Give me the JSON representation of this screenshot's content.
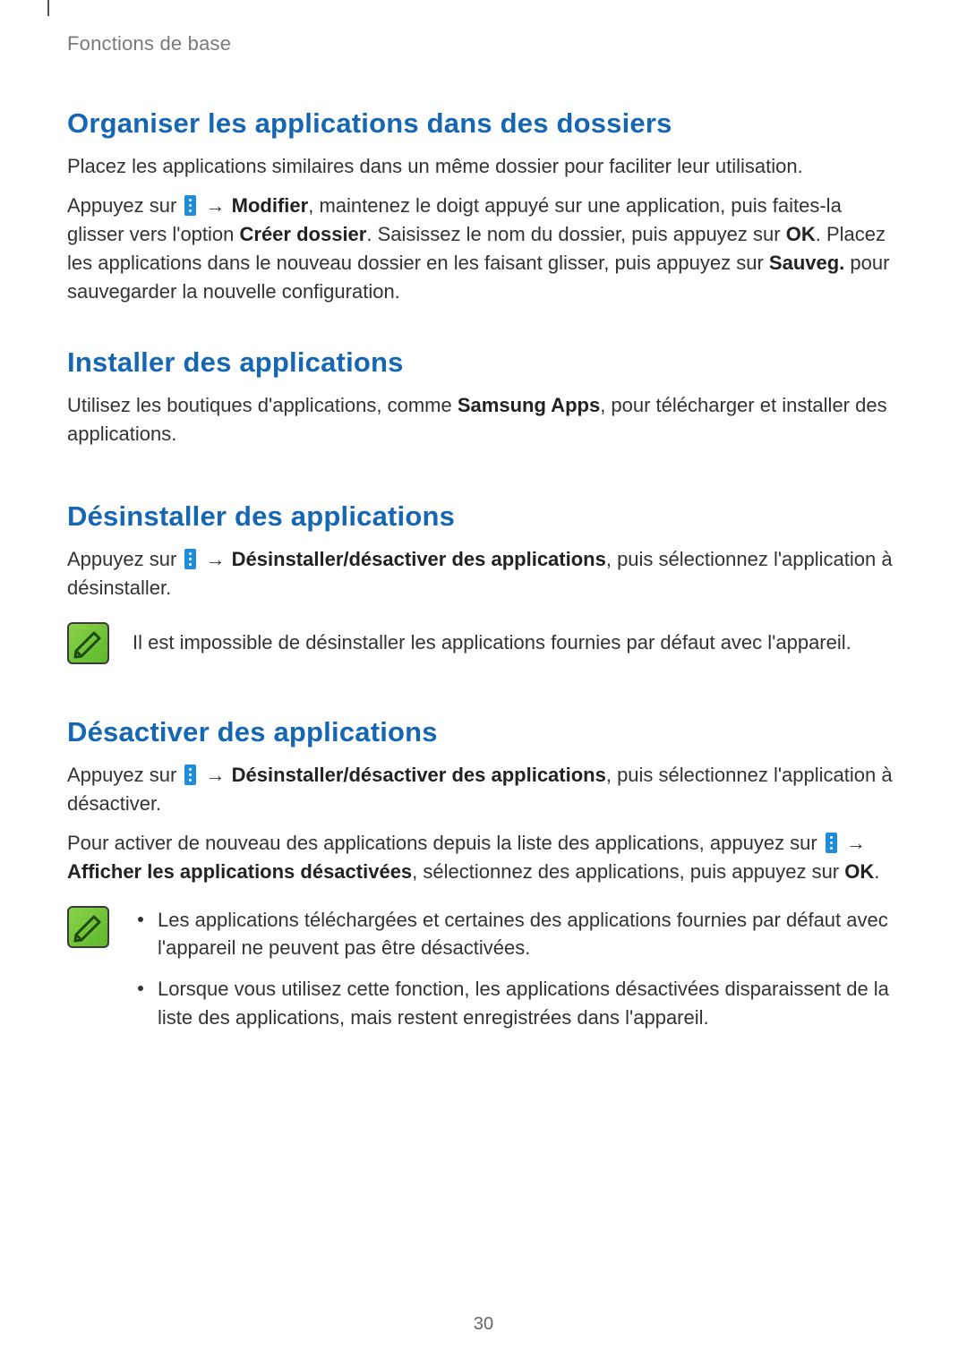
{
  "breadcrumb": "Fonctions de base",
  "page_number": "30",
  "sections": {
    "s1": {
      "heading": "Organiser les applications dans des dossiers",
      "p1": "Placez les applications similaires dans un même dossier pour faciliter leur utilisation.",
      "p2_a": "Appuyez sur ",
      "p2_arrow": "→",
      "p2_b_bold": "Modifier",
      "p2_c": ", maintenez le doigt appuyé sur une application, puis faites-la glisser vers l'option ",
      "p2_d_bold": "Créer dossier",
      "p2_e": ". Saisissez le nom du dossier, puis appuyez sur ",
      "p2_f_bold": "OK",
      "p2_g": ". Placez les applications dans le nouveau dossier en les faisant glisser, puis appuyez sur ",
      "p2_h_bold": "Sauveg.",
      "p2_i": " pour sauvegarder la nouvelle configuration."
    },
    "s2": {
      "heading": "Installer des applications",
      "p1_a": "Utilisez les boutiques d'applications, comme ",
      "p1_b_bold": "Samsung Apps",
      "p1_c": ", pour télécharger et installer des applications."
    },
    "s3": {
      "heading": "Désinstaller des applications",
      "p1_a": "Appuyez sur ",
      "p1_arrow": "→",
      "p1_b_bold": "Désinstaller/désactiver des applications",
      "p1_c": ", puis sélectionnez l'application à désinstaller.",
      "note": "Il est impossible de désinstaller les applications fournies par défaut avec l'appareil."
    },
    "s4": {
      "heading": "Désactiver des applications",
      "p1_a": "Appuyez sur ",
      "p1_arrow": "→",
      "p1_b_bold": "Désinstaller/désactiver des applications",
      "p1_c": ", puis sélectionnez l'application à désactiver.",
      "p2_a": "Pour activer de nouveau des applications depuis la liste des applications, appuyez sur ",
      "p2_arrow": "→",
      "p2_b_bold": "Afficher les applications désactivées",
      "p2_c": ", sélectionnez des applications, puis appuyez sur ",
      "p2_d_bold": "OK",
      "p2_e": ".",
      "note_items": [
        "Les applications téléchargées et certaines des applications fournies par défaut avec l'appareil ne peuvent pas être désactivées.",
        "Lorsque vous utilisez cette fonction, les applications désactivées disparaissent de la liste des applications, mais restent enregistrées dans l'appareil."
      ]
    }
  }
}
